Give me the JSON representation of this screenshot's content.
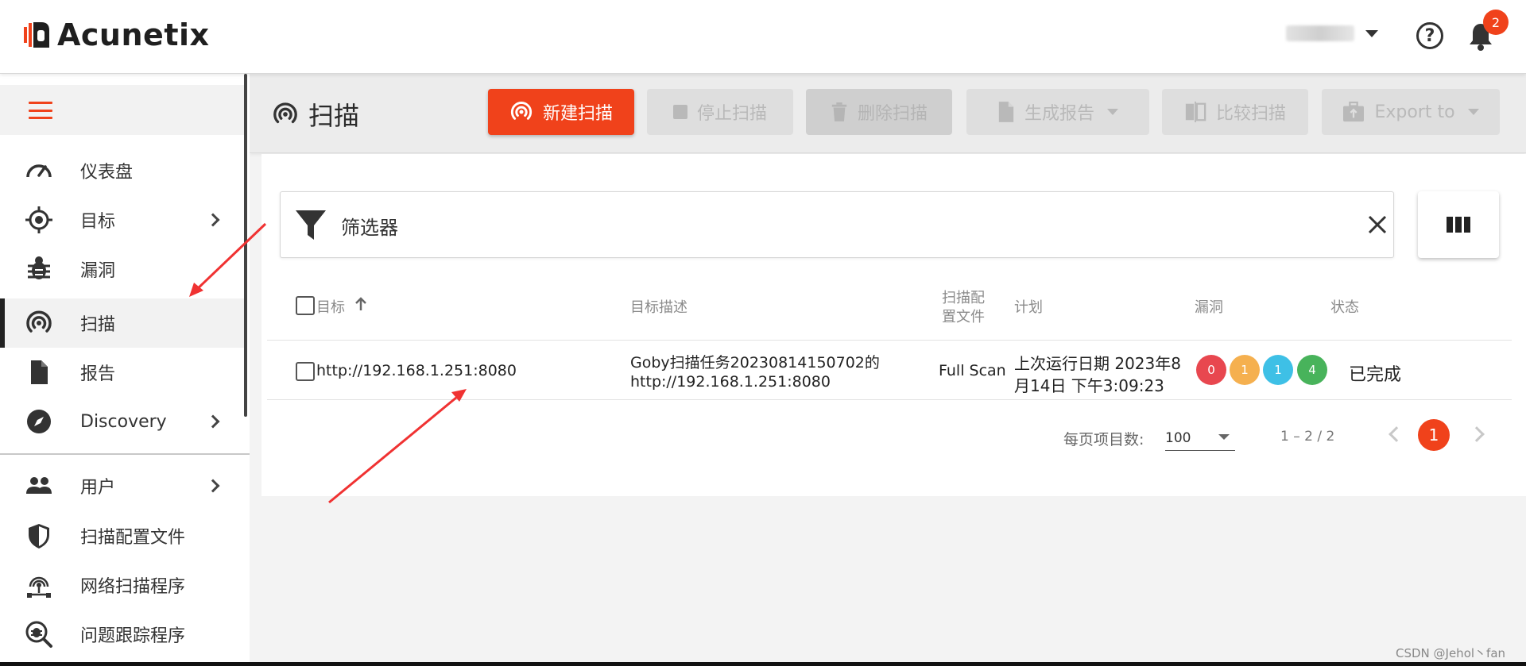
{
  "app": {
    "logo_text": "Acunetix",
    "notifications_count": "2",
    "help_glyph": "?"
  },
  "sidebar": {
    "items": [
      {
        "label": "仪表盘",
        "icon": "speedometer-icon"
      },
      {
        "label": "目标",
        "icon": "target-icon"
      },
      {
        "label": "漏洞",
        "icon": "bug-icon"
      },
      {
        "label": "扫描",
        "icon": "scan-radar-icon"
      },
      {
        "label": "报告",
        "icon": "report-file-icon"
      },
      {
        "label": "Discovery",
        "icon": "compass-icon"
      },
      {
        "label": "用户",
        "icon": "users-icon"
      },
      {
        "label": "扫描配置文件",
        "icon": "shield-icon"
      },
      {
        "label": "网络扫描程序",
        "icon": "network-scanner-icon"
      },
      {
        "label": "问题跟踪程序",
        "icon": "issue-tracker-icon"
      }
    ]
  },
  "toolbar": {
    "page_title": "扫描",
    "new_scan": "新建扫描",
    "stop_scan": "停止扫描",
    "delete_scan": "删除扫描",
    "generate_report": "生成报告",
    "compare_scans": "比较扫描",
    "export_to": "Export to"
  },
  "filter": {
    "label": "筛选器"
  },
  "table": {
    "headers": {
      "target": "目标",
      "description": "目标描述",
      "profile_line1": "扫描配",
      "profile_line2": "置文件",
      "schedule": "计划",
      "vulnerabilities": "漏洞",
      "status": "状态"
    },
    "rows": [
      {
        "target": "http://192.168.1.251:8080",
        "description_line1": "Goby扫描任务20230814150702的",
        "description_line2": "http://192.168.1.251:8080",
        "profile": "Full Scan",
        "schedule_line1": "上次运行日期 2023年8",
        "schedule_line2": "月14日 下午3:09:23",
        "vulns": {
          "critical": "0",
          "high": "1",
          "medium": "1",
          "low": "4"
        },
        "status": "已完成"
      }
    ]
  },
  "pagination": {
    "per_page_label": "每页项目数:",
    "per_page_value": "100",
    "range": "1 – 2 / 2",
    "current_page": "1"
  },
  "watermark": "CSDN @Jehol丶fan",
  "colors": {
    "accent": "#f0421b",
    "critical": "#e8474f",
    "high": "#f5b04f",
    "medium": "#3ec0e6",
    "low": "#48b35b"
  }
}
